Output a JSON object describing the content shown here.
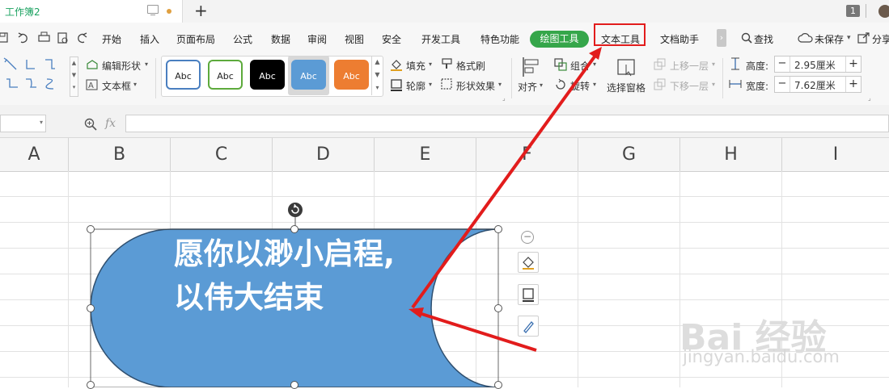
{
  "title_bar": {
    "doc_tab_title": "工作簿2",
    "new_tab": "+",
    "window_count": "1"
  },
  "menu": {
    "items": [
      "开始",
      "插入",
      "页面布局",
      "公式",
      "数据",
      "审阅",
      "视图",
      "安全",
      "开发工具",
      "特色功能",
      "绘图工具",
      "文本工具",
      "文档助手"
    ],
    "active_tab": "绘图工具",
    "search": "查找",
    "unsaved": "未保存",
    "share": "分享"
  },
  "ribbon": {
    "edit_shape": "编辑形状",
    "text_box": "文本框",
    "style_buttons": [
      {
        "label": "Abc",
        "bg": "#ffffff",
        "border": "#4a7fc0",
        "color": "#222222"
      },
      {
        "label": "Abc",
        "bg": "#ffffff",
        "border": "#5daa3c",
        "color": "#222222"
      },
      {
        "label": "Abc",
        "bg": "#000000",
        "border": "#000000",
        "color": "#ffffff"
      },
      {
        "label": "Abc",
        "bg": "#5b9bd5",
        "border": "#5b9bd5",
        "color": "#ffffff"
      },
      {
        "label": "Abc",
        "bg": "#ed7d31",
        "border": "#ed7d31",
        "color": "#ffffff"
      }
    ],
    "fill": "填充",
    "format_painter": "格式刷",
    "outline": "轮廓",
    "shape_effects": "形状效果",
    "align": "对齐",
    "group": "组合",
    "rotate": "旋转",
    "selection_pane": "选择窗格",
    "bring_forward": "上移一层",
    "send_backward": "下移一层",
    "height_label": "高度:",
    "height_value": "2.95厘米",
    "width_label": "宽度:",
    "width_value": "7.62厘米"
  },
  "formula_bar": {
    "fx": "fx",
    "value": ""
  },
  "columns": [
    "A",
    "B",
    "C",
    "D",
    "E",
    "F",
    "G",
    "H",
    "I"
  ],
  "shape": {
    "line1": "愿你以渺小启程,",
    "line2": "以伟大结束",
    "fill_color": "#5b9bd5"
  },
  "watermark": {
    "logo": "Bai 经验",
    "url": "jingyan.baidu.com"
  },
  "colors": {
    "accent_green": "#35a64a",
    "annotation_red": "#e21c1c"
  }
}
